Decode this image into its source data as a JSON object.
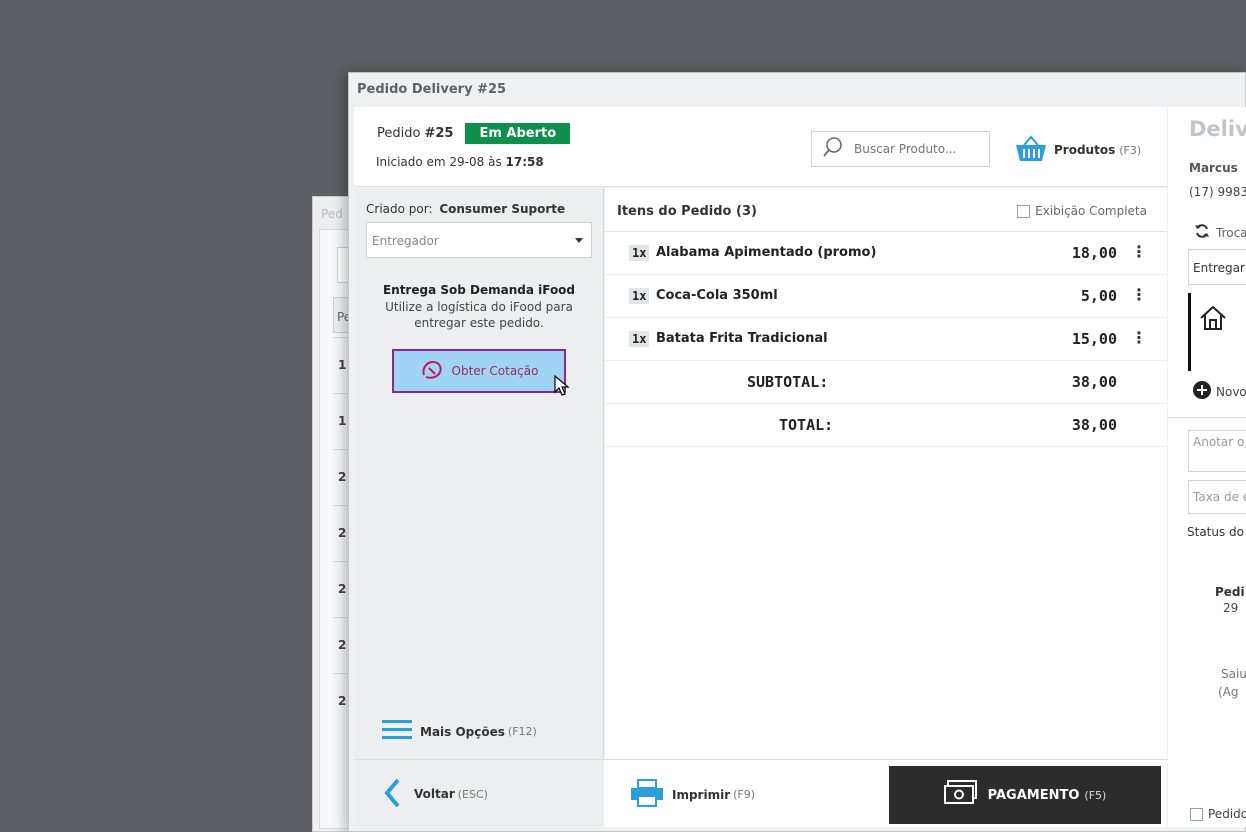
{
  "background_window": {
    "title": "Ped",
    "column_header": "Pe",
    "rows": [
      "1",
      "1",
      "2",
      "2",
      "2",
      "2",
      "2"
    ]
  },
  "window": {
    "title": "Pedido Delivery #25"
  },
  "header": {
    "pedido_label": "Pedido",
    "pedido_number": "#25",
    "status": "Em Aberto",
    "iniciado_label": "Iniciado em 29-08 às",
    "iniciado_time": "17:58",
    "search_placeholder": "Buscar Produto...",
    "produtos_label": "Produtos",
    "produtos_hotkey": "(F3)"
  },
  "left": {
    "criado_label": "Criado por:",
    "criado_value": "Consumer Suporte",
    "entregador_placeholder": "Entregador",
    "ifood_title": "Entrega Sob Demanda iFood",
    "ifood_desc": "Utilize a logística do iFood para entregar este pedido.",
    "cotacao_label": "Obter Cotação",
    "mais_opcoes_label": "Mais Opções",
    "mais_opcoes_hotkey": "(F12)"
  },
  "items": {
    "title": "Itens do Pedido (3)",
    "exibicao_label": "Exibição Completa",
    "list": [
      {
        "qty": "1x",
        "name": "Alabama Apimentado (promo)",
        "price": "18,00"
      },
      {
        "qty": "1x",
        "name": "Coca-Cola 350ml",
        "price": "5,00"
      },
      {
        "qty": "1x",
        "name": "Batata Frita Tradicional",
        "price": "15,00"
      }
    ],
    "subtotal_label": "SUBTOTAL:",
    "subtotal_value": "38,00",
    "total_label": "TOTAL:",
    "total_value": "38,00"
  },
  "footer": {
    "voltar_label": "Voltar",
    "voltar_hotkey": "(ESC)",
    "imprimir_label": "Imprimir",
    "imprimir_hotkey": "(F9)",
    "pagamento_label": "PAGAMENTO",
    "pagamento_hotkey": "(F5)"
  },
  "right": {
    "title": "Delive",
    "customer_name": "Marcus",
    "customer_phone": "(17) 9983",
    "troca_label": "Troca",
    "entregar_value": "Entregar",
    "novo_label": "Novo",
    "anotar_placeholder": "Anotar o",
    "taxa_placeholder": "Taxa de e",
    "status_label": "Status do",
    "pedi_label": "Pedi",
    "pedi_value": "29",
    "saiu_label": "Saiu",
    "ag_label": "(Ag",
    "pedido_chk_label": "Pedido"
  },
  "colors": {
    "status_green": "#0e8f4b",
    "cotacao_bg": "#9fd4f5",
    "cotacao_border": "#8a2a8a",
    "accent_blue": "#2a9fd8",
    "pagamento_bg": "#2c2c2c"
  },
  "icons": {
    "search": "search-icon",
    "basket": "basket-icon",
    "ifood": "ifood-logo-icon",
    "menu": "hamburger-icon",
    "back": "chevron-left-icon",
    "printer": "printer-icon",
    "money": "money-icon",
    "refresh": "refresh-icon",
    "home": "home-icon",
    "plus": "plus-circle-icon"
  }
}
